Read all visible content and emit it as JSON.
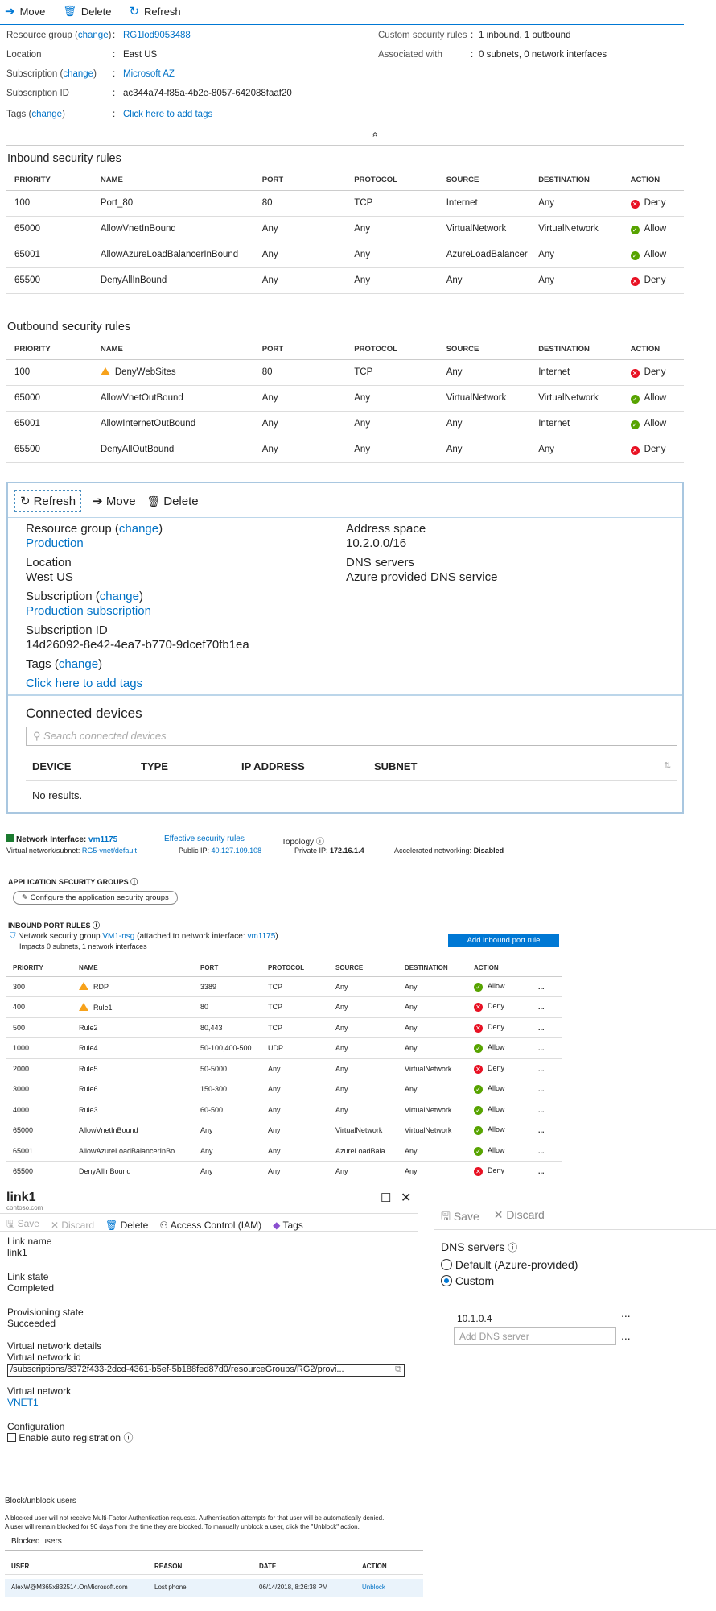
{
  "nsg": {
    "toolbar": {
      "move": "Move",
      "delete": "Delete",
      "refresh": "Refresh"
    },
    "essentials_left": [
      {
        "label": "Resource group",
        "change": "change",
        "value": "RG1lod9053488",
        "value_link": true
      },
      {
        "label": "Location",
        "change": "",
        "value": "East US",
        "value_link": false
      },
      {
        "label": "Subscription",
        "change": "change",
        "value": "Microsoft AZ",
        "value_link": true
      },
      {
        "label": "Subscription ID",
        "change": "",
        "value": "ac344a74-f85a-4b2e-8057-642088faaf20",
        "value_link": false
      },
      {
        "label": "Tags",
        "change": "change",
        "value": "Click here to add tags",
        "value_link": true
      }
    ],
    "essentials_right": [
      {
        "label": "Custom security rules",
        "value": "1 inbound, 1 outbound"
      },
      {
        "label": "Associated with",
        "value": "0 subnets, 0 network interfaces"
      }
    ],
    "collapse_glyph": "»",
    "inbound_title": "Inbound security rules",
    "outbound_title": "Outbound security rules",
    "columns": [
      "PRIORITY",
      "NAME",
      "PORT",
      "PROTOCOL",
      "SOURCE",
      "DESTINATION",
      "ACTION"
    ],
    "inbound": [
      {
        "priority": "100",
        "name": "Port_80",
        "warn": false,
        "port": "80",
        "protocol": "TCP",
        "source": "Internet",
        "destination": "Any",
        "action": "Deny"
      },
      {
        "priority": "65000",
        "name": "AllowVnetInBound",
        "warn": false,
        "port": "Any",
        "protocol": "Any",
        "source": "VirtualNetwork",
        "destination": "VirtualNetwork",
        "action": "Allow"
      },
      {
        "priority": "65001",
        "name": "AllowAzureLoadBalancerInBound",
        "warn": false,
        "port": "Any",
        "protocol": "Any",
        "source": "AzureLoadBalancer",
        "destination": "Any",
        "action": "Allow"
      },
      {
        "priority": "65500",
        "name": "DenyAllInBound",
        "warn": false,
        "port": "Any",
        "protocol": "Any",
        "source": "Any",
        "destination": "Any",
        "action": "Deny"
      }
    ],
    "outbound": [
      {
        "priority": "100",
        "name": "DenyWebSites",
        "warn": true,
        "port": "80",
        "protocol": "TCP",
        "source": "Any",
        "destination": "Internet",
        "action": "Deny"
      },
      {
        "priority": "65000",
        "name": "AllowVnetOutBound",
        "warn": false,
        "port": "Any",
        "protocol": "Any",
        "source": "VirtualNetwork",
        "destination": "VirtualNetwork",
        "action": "Allow"
      },
      {
        "priority": "65001",
        "name": "AllowInternetOutBound",
        "warn": false,
        "port": "Any",
        "protocol": "Any",
        "source": "Any",
        "destination": "Internet",
        "action": "Allow"
      },
      {
        "priority": "65500",
        "name": "DenyAllOutBound",
        "warn": false,
        "port": "Any",
        "protocol": "Any",
        "source": "Any",
        "destination": "Any",
        "action": "Deny"
      }
    ]
  },
  "vnet": {
    "toolbar": {
      "refresh": "Refresh",
      "move": "Move",
      "delete": "Delete"
    },
    "rg_label": "Resource group",
    "rg_change": "change",
    "rg_value": "Production",
    "loc_label": "Location",
    "loc_value": "West US",
    "sub_label": "Subscription",
    "sub_change": "change",
    "sub_value": "Production subscription",
    "subid_label": "Subscription ID",
    "subid_value": "14d26092-8e42-4ea7-b770-9dcef70fb1ea",
    "tags_label": "Tags",
    "tags_change": "change",
    "tags_value": "Click here to add tags",
    "addr_label": "Address space",
    "addr_value": "10.2.0.0/16",
    "dns_label": "DNS servers",
    "dns_value": "Azure provided DNS service",
    "connected_title": "Connected devices",
    "search_placeholder": "Search connected devices",
    "columns": [
      "DEVICE",
      "TYPE",
      "IP ADDRESS",
      "SUBNET"
    ],
    "no_results": "No results."
  },
  "nic": {
    "ni_label": "Network Interface:",
    "ni_value": "vm1175",
    "effective_link": "Effective security rules",
    "topology": "Topology",
    "vnet_label": "Virtual network/subnet:",
    "vnet_value": "RG5-vnet/default",
    "public_label": "Public IP:",
    "public_value": "40.127.109.108",
    "private_label": "Private IP:",
    "private_value": "172.16.1.4",
    "accel_label": "Accelerated networking:",
    "accel_value": "Disabled",
    "asg_title": "APPLICATION SECURITY GROUPS",
    "asg_button": "Configure the application security groups",
    "inbound_title": "INBOUND PORT RULES",
    "nsg_prefix": "Network security group",
    "nsg_name": "VM1-nsg",
    "nsg_mid": "(attached to network interface:",
    "nsg_nic": "vm1175",
    "nsg_suffix": ")",
    "impacts": "Impacts 0 subnets, 1 network interfaces",
    "add_button": "Add inbound port rule",
    "columns": [
      "PRIORITY",
      "NAME",
      "PORT",
      "PROTOCOL",
      "SOURCE",
      "DESTINATION",
      "ACTION"
    ],
    "rules": [
      {
        "priority": "300",
        "name": "RDP",
        "warn": true,
        "port": "3389",
        "protocol": "TCP",
        "source": "Any",
        "destination": "Any",
        "action": "Allow"
      },
      {
        "priority": "400",
        "name": "Rule1",
        "warn": true,
        "port": "80",
        "protocol": "TCP",
        "source": "Any",
        "destination": "Any",
        "action": "Deny"
      },
      {
        "priority": "500",
        "name": "Rule2",
        "warn": false,
        "port": "80,443",
        "protocol": "TCP",
        "source": "Any",
        "destination": "Any",
        "action": "Deny"
      },
      {
        "priority": "1000",
        "name": "Rule4",
        "warn": false,
        "port": "50-100,400-500",
        "protocol": "UDP",
        "source": "Any",
        "destination": "Any",
        "action": "Allow"
      },
      {
        "priority": "2000",
        "name": "Rule5",
        "warn": false,
        "port": "50-5000",
        "protocol": "Any",
        "source": "Any",
        "destination": "VirtualNetwork",
        "action": "Deny"
      },
      {
        "priority": "3000",
        "name": "Rule6",
        "warn": false,
        "port": "150-300",
        "protocol": "Any",
        "source": "Any",
        "destination": "Any",
        "action": "Allow"
      },
      {
        "priority": "4000",
        "name": "Rule3",
        "warn": false,
        "port": "60-500",
        "protocol": "Any",
        "source": "Any",
        "destination": "VirtualNetwork",
        "action": "Allow"
      },
      {
        "priority": "65000",
        "name": "AllowVnetInBound",
        "warn": false,
        "port": "Any",
        "protocol": "Any",
        "source": "VirtualNetwork",
        "destination": "VirtualNetwork",
        "action": "Allow"
      },
      {
        "priority": "65001",
        "name": "AllowAzureLoadBalancerInBo...",
        "warn": false,
        "port": "Any",
        "protocol": "Any",
        "source": "AzureLoadBala...",
        "destination": "Any",
        "action": "Allow"
      },
      {
        "priority": "65500",
        "name": "DenyAllInBound",
        "warn": false,
        "port": "Any",
        "protocol": "Any",
        "source": "Any",
        "destination": "Any",
        "action": "Deny"
      }
    ],
    "more": "..."
  },
  "link1": {
    "title": "link1",
    "subtitle": "contoso.com",
    "toolbar": {
      "save": "Save",
      "discard": "Discard",
      "delete": "Delete",
      "iam": "Access Control (IAM)",
      "tags": "Tags"
    },
    "link_name_label": "Link name",
    "link_name_value": "link1",
    "link_state_label": "Link state",
    "link_state_value": "Completed",
    "prov_label": "Provisioning state",
    "prov_value": "Succeeded",
    "vnet_details_label": "Virtual network details",
    "vnet_id_label": "Virtual network id",
    "vnet_id_value": "/subscriptions/8372f433-2dcd-4361-b5ef-5b188fed87d0/resourceGroups/RG2/provi...",
    "vnet_label": "Virtual network",
    "vnet_value": "VNET1",
    "config_label": "Configuration",
    "auto_reg_label": "Enable auto registration"
  },
  "dns": {
    "toolbar": {
      "save": "Save",
      "discard": "Discard"
    },
    "title": "DNS servers",
    "opt_default": "Default (Azure-provided)",
    "opt_custom": "Custom",
    "server1": "10.1.0.4",
    "add_placeholder": "Add DNS server",
    "more": "..."
  },
  "block": {
    "title": "Block/unblock users",
    "desc1": "A blocked user will not receive Multi-Factor Authentication requests. Authentication attempts for that user will be automatically denied.",
    "desc2": "A user will remain blocked for 90 days from the time they are blocked. To manually unblock a user, click the \"Unblock\" action.",
    "tab": "Blocked users",
    "columns": [
      "USER",
      "REASON",
      "DATE",
      "ACTION"
    ],
    "row": {
      "user": "AlexW@M365x832514.OnMicrosoft.com",
      "reason": "Lost phone",
      "date": "06/14/2018, 8:26:38 PM",
      "action": "Unblock"
    }
  },
  "colors": {
    "accent": "#0078d4",
    "deny": "#e81123",
    "allow": "#57a300",
    "warn": "#f7a21b"
  }
}
